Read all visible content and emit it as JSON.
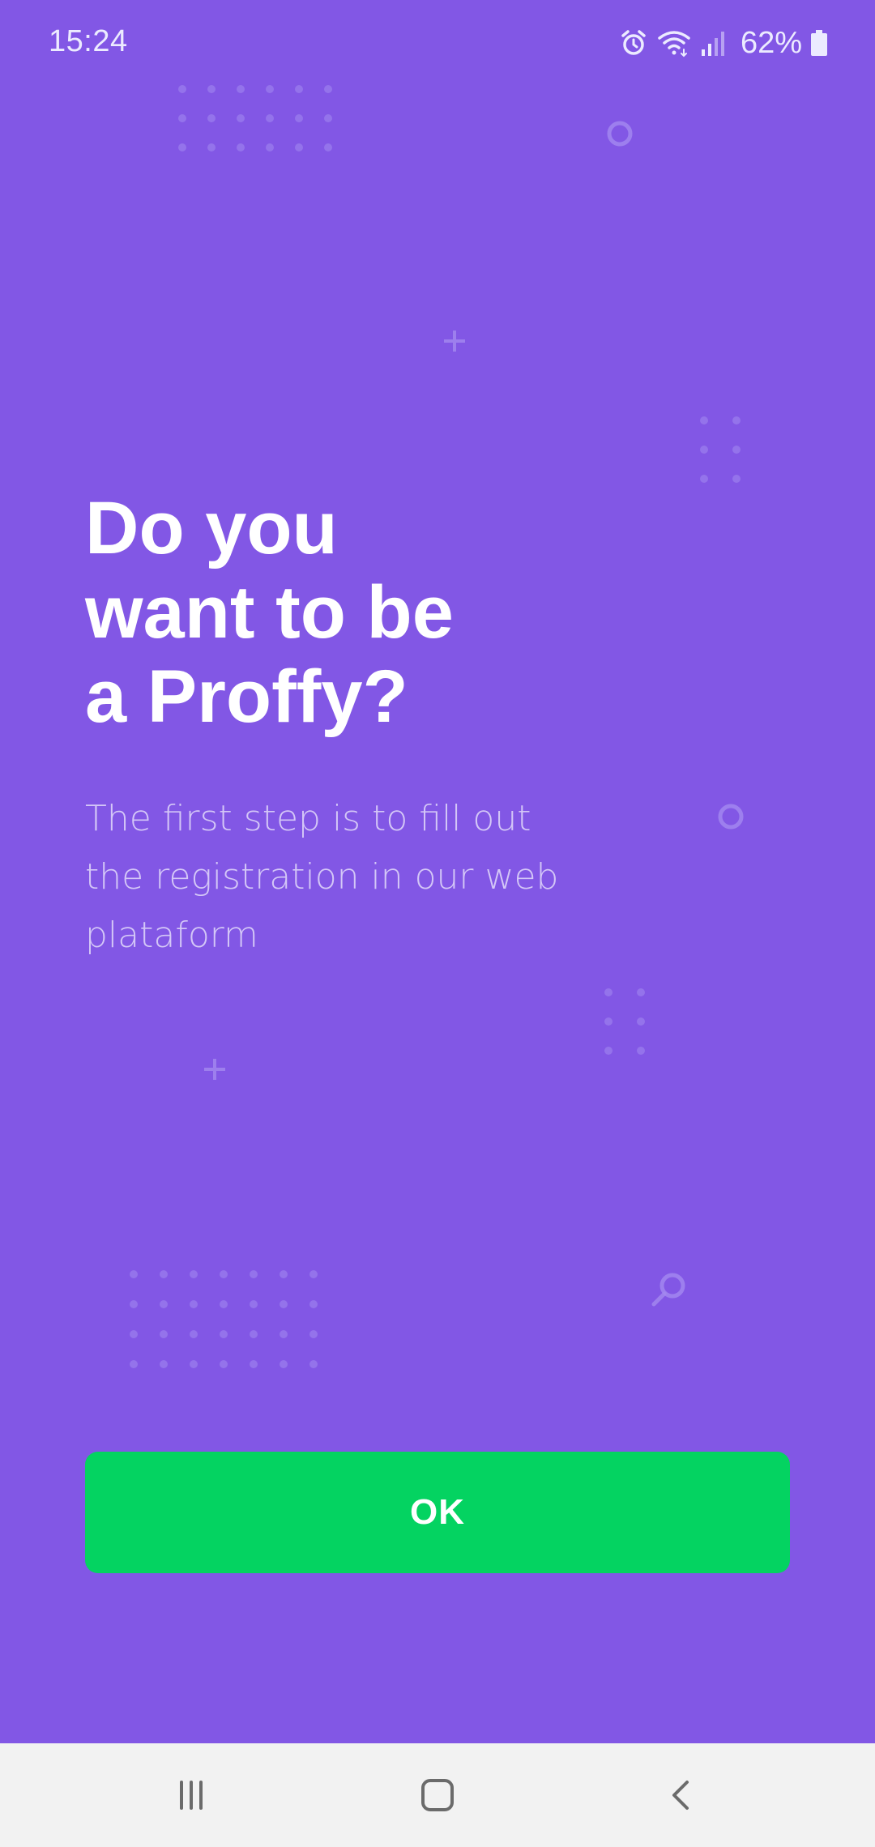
{
  "status_bar": {
    "time": "15:24",
    "battery": "62%",
    "icons": [
      "alarm-icon",
      "wifi-icon",
      "signal-icon",
      "battery-icon"
    ]
  },
  "main": {
    "title_lines": [
      "Do you",
      "want to be",
      "a Proffy?"
    ],
    "description_lines": [
      "The first step is to fill out",
      "the registration in our web",
      "plataform"
    ],
    "ok_label": "OK"
  },
  "nav_bar": {
    "icons": [
      "recent-apps-icon",
      "home-icon",
      "back-icon"
    ]
  },
  "colors": {
    "background": "#8257e5",
    "button": "#04d361",
    "title": "#ffffff",
    "description": "#d4c7f7",
    "nav_background": "#f2f2f2"
  }
}
